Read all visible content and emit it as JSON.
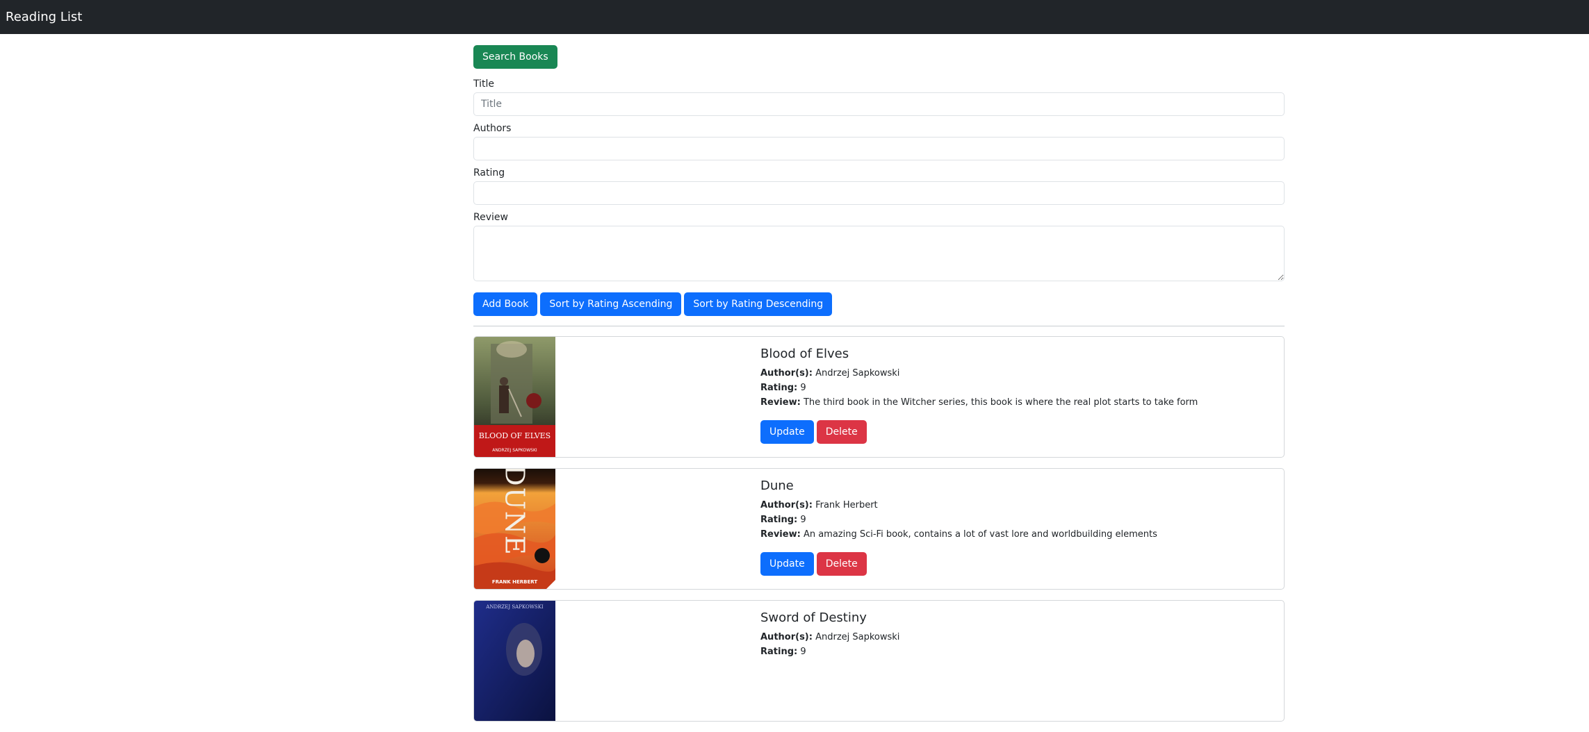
{
  "navbar": {
    "brand": "Reading List"
  },
  "search": {
    "button_label": "Search Books"
  },
  "form": {
    "title_label": "Title",
    "title_placeholder": "Title",
    "title_value": "",
    "authors_label": "Authors",
    "authors_value": "",
    "rating_label": "Rating",
    "rating_value": "",
    "review_label": "Review",
    "review_value": ""
  },
  "actions": {
    "add_label": "Add Book",
    "sort_asc_label": "Sort by Rating Ascending",
    "sort_desc_label": "Sort by Rating Descending"
  },
  "field_labels": {
    "authors": "Author(s):",
    "rating": "Rating:",
    "review": "Review:"
  },
  "card_buttons": {
    "update": "Update",
    "delete": "Delete"
  },
  "books": [
    {
      "title": "Blood of Elves",
      "authors": "Andrzej Sapkowski",
      "rating": "9",
      "review": "The third book in the Witcher series, this book is where the real plot starts to take form",
      "cover_text": "BLOOD OF ELVES",
      "cover_author": "ANDRZEJ SAPKOWSKI"
    },
    {
      "title": "Dune",
      "authors": "Frank Herbert",
      "rating": "9",
      "review": "An amazing Sci-Fi book, contains a lot of vast lore and worldbuilding elements",
      "cover_text": "DUNE",
      "cover_author": "FRANK HERBERT"
    },
    {
      "title": "Sword of Destiny",
      "authors": "Andrzej Sapkowski",
      "rating": "9",
      "review": "",
      "cover_text": "",
      "cover_author": "ANDRZEJ SAPKOWSKI"
    }
  ]
}
